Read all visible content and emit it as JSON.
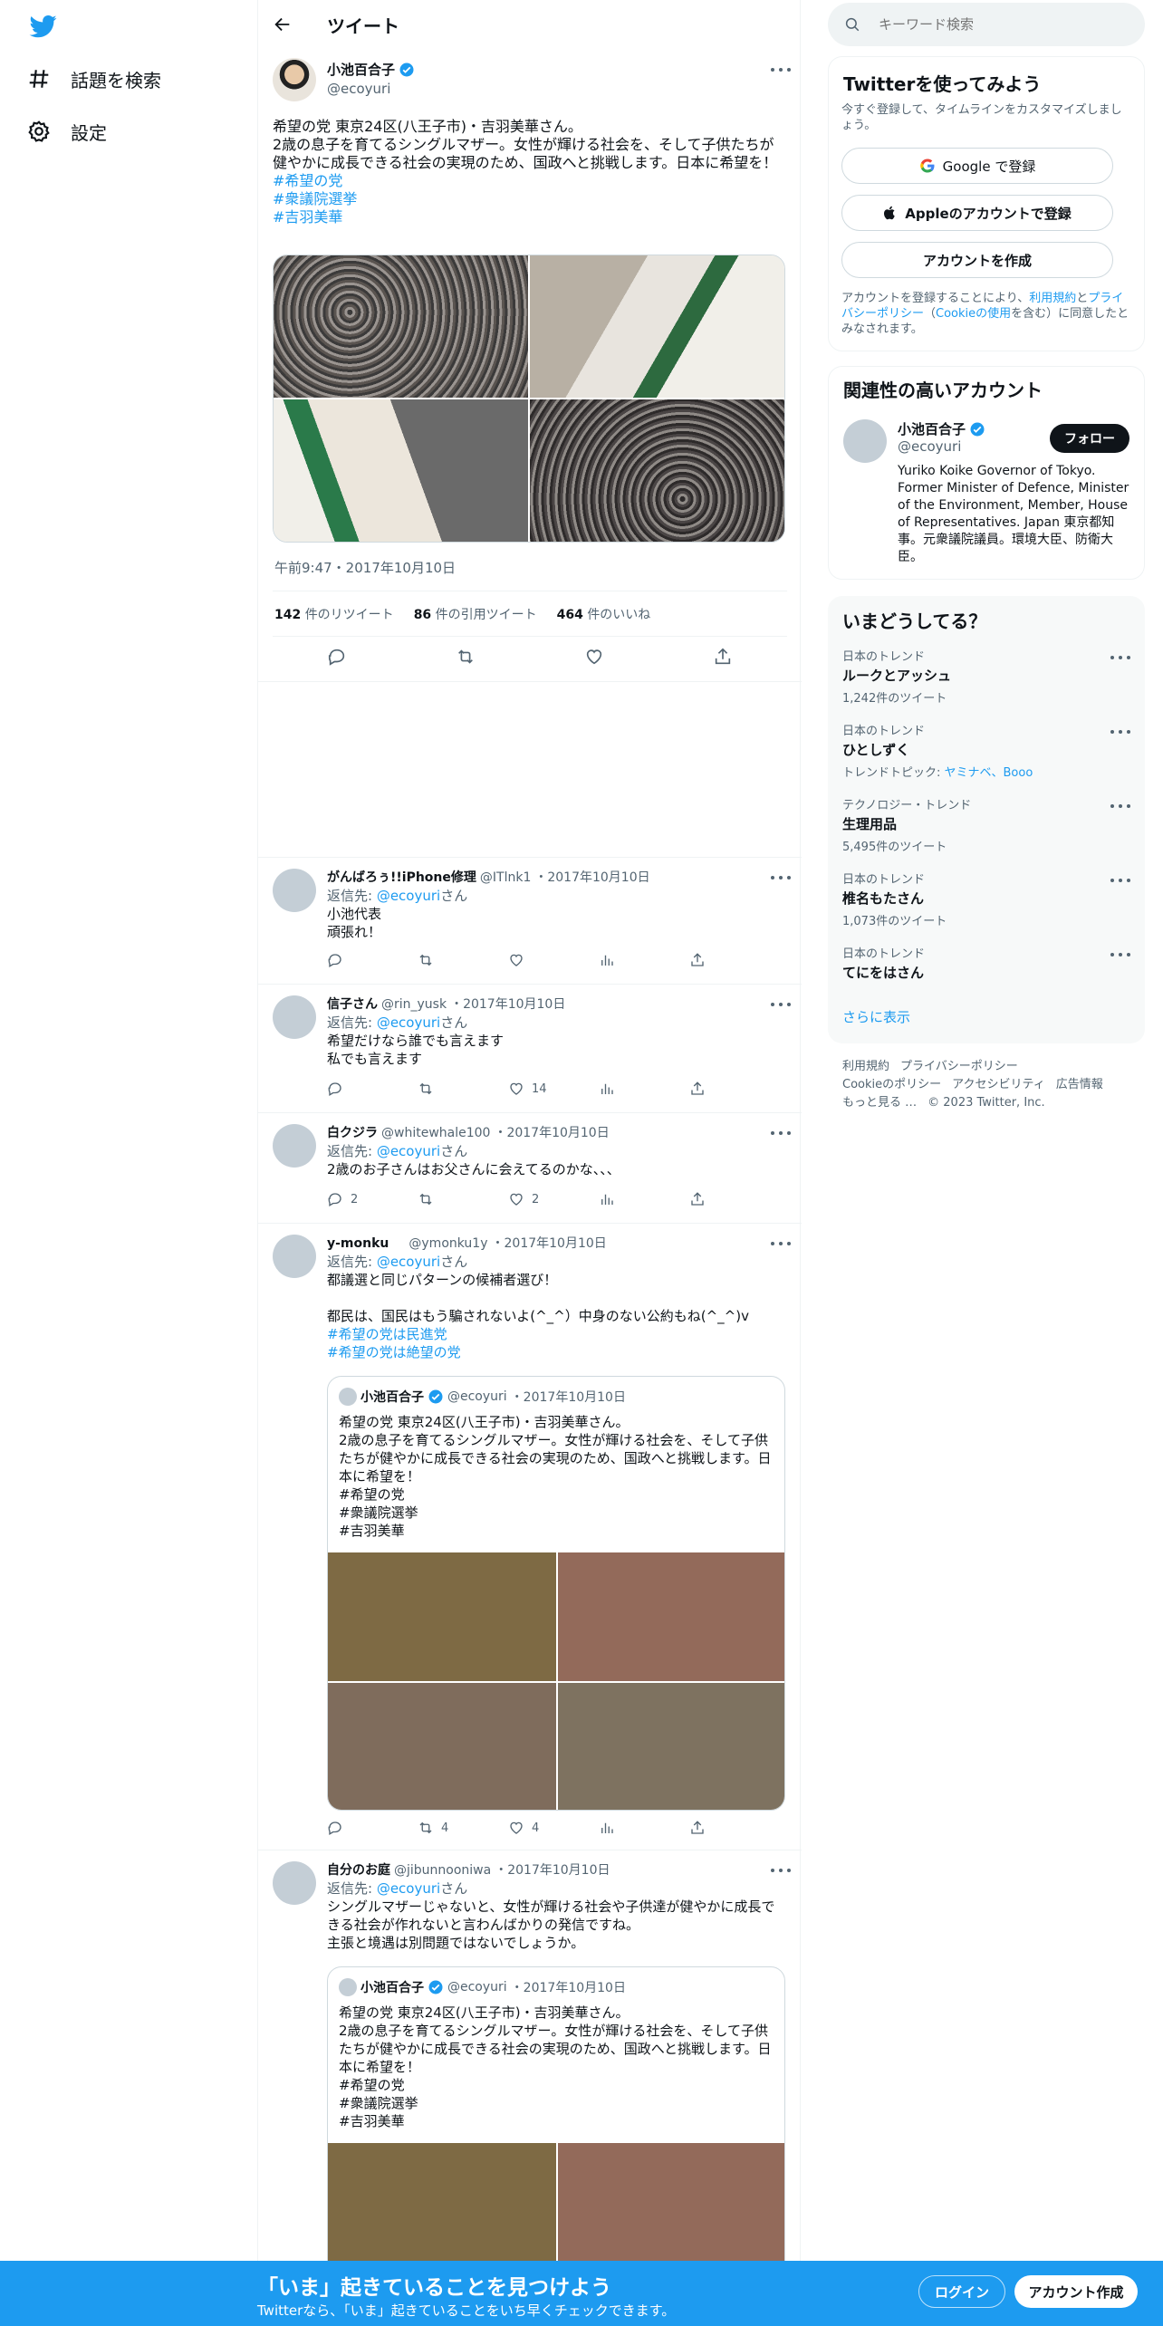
{
  "nav": {
    "explore_label": "話題を検索",
    "settings_label": "設定"
  },
  "header": {
    "title": "ツイート"
  },
  "tweet": {
    "author_name": "小池百合子",
    "author_handle": "@ecoyuri",
    "text": "希望の党 東京24区(八王子市)・吉羽美華さん。\n2歳の息子を育てるシングルマザー。女性が輝ける社会を、そして子供たちが健やかに成長できる社会の実現のため、国政へと挑戦します。日本に希望を！",
    "hashtags": [
      "#希望の党",
      "#衆議院選挙",
      "#吉羽美華"
    ],
    "timestamp": "午前9:47・2017年10月10日",
    "retweets": "142",
    "retweets_label": "件のリツイート",
    "quotes": "86",
    "quotes_label": "件の引用ツイート",
    "likes": "464",
    "likes_label": "件のいいね"
  },
  "replies": [
    {
      "name": "がんばろぅ!!iPhone修理",
      "handle": "@ITlnk1",
      "date": "・2017年10月10日",
      "to_prefix": "返信先: ",
      "to_handle": "@ecoyuri",
      "to_suffix": "さん",
      "lines": [
        "小池代表",
        "頑張れ！"
      ],
      "reply_count": "",
      "retweet_count": "",
      "like_count": ""
    },
    {
      "name": "信子さん",
      "handle": "@rin_yusk",
      "date": "・2017年10月10日",
      "to_prefix": "返信先: ",
      "to_handle": "@ecoyuri",
      "to_suffix": "さん",
      "lines": [
        "希望だけなら誰でも言えます",
        "私でも言えます"
      ],
      "reply_count": "",
      "retweet_count": "",
      "like_count": "14"
    },
    {
      "name": "白クジラ",
      "handle": "@whitewhale100",
      "date": "・2017年10月10日",
      "to_prefix": "返信先: ",
      "to_handle": "@ecoyuri",
      "to_suffix": "さん",
      "lines": [
        "2歳のお子さんはお父さんに会えてるのかな、、、"
      ],
      "reply_count": "2",
      "retweet_count": "",
      "like_count": "2"
    },
    {
      "name": "y-monku",
      "handle": "@ymonku1y",
      "date": "・2017年10月10日",
      "to_prefix": "返信先: ",
      "to_handle": "@ecoyuri",
      "to_suffix": "さん",
      "lines": [
        "都議選と同じパターンの候補者選び！",
        "",
        "都民は、国民はもう騙されないよ(^_^）中身のない公約もね(^_^)v"
      ],
      "hashtags": [
        "#希望の党は民進党",
        "#希望の党は絶望の党"
      ],
      "reply_count": "",
      "retweet_count": "4",
      "like_count": "4"
    },
    {
      "name": "自分のお庭",
      "handle": "@jibunnooniwa",
      "date": "・2017年10月10日",
      "to_prefix": "返信先: ",
      "to_handle": "@ecoyuri",
      "to_suffix": "さん",
      "lines": [
        "シングルマザーじゃないと、女性が輝ける社会や子供達が健やかに成長できる社会が作れないと言わんばかりの発信ですね。",
        "主張と境遇は別問題ではないでしょうか。"
      ]
    }
  ],
  "quote": {
    "name": "小池百合子",
    "handle": "@ecoyuri",
    "date": "・2017年10月10日",
    "lines": [
      "希望の党 東京24区(八王子市)・吉羽美華さん。",
      "2歳の息子を育てるシングルマザー。女性が輝ける社会を、そして子供たちが健やかに成長できる社会の実現のため、国政へと挑戦します。日本に希望を！",
      "#希望の党",
      "#衆議院選挙",
      "#吉羽美華"
    ]
  },
  "search": {
    "placeholder": "キーワード検索"
  },
  "signup_box": {
    "title": "Twitterを使ってみよう",
    "subtitle": "今すぐ登録して、タイムラインをカスタマイズしましょう。",
    "google_label": "Google で登録",
    "apple_label": "Appleのアカウントで登録",
    "create_label": "アカウントを作成",
    "terms_pre": "アカウントを登録することにより、",
    "terms_link": "利用規約",
    "terms_mid": "と",
    "privacy_link": "プライバシーポリシー",
    "cookie_pre": "（",
    "cookie_link": "Cookieの使用",
    "terms_post": "を含む）に同意したとみなされます。"
  },
  "related": {
    "title": "関連性の高いアカウント",
    "name": "小池百合子",
    "handle": "@ecoyuri",
    "follow_label": "フォロー",
    "bio": "Yuriko Koike Governor of Tokyo. Former Minister of Defence, Minister of the Environment, Member, House of Representatives. Japan 東京都知事。元衆議院議員。環境大臣、防衛大臣。"
  },
  "trends": {
    "title": "いまどうしてる？",
    "items": [
      {
        "category": "日本のトレンド",
        "name": "ルークとアッシュ",
        "count": "1,242件のツイート"
      },
      {
        "category": "日本のトレンド",
        "name": "ひとしずく",
        "topic_prefix": "トレンドトピック: ",
        "topic_links": "ヤミナベ、Booo"
      },
      {
        "category": "テクノロジー・トレンド",
        "name": "生理用品",
        "count": "5,495件のツイート"
      },
      {
        "category": "日本のトレンド",
        "name": "椎名もたさん",
        "count": "1,073件のツイート"
      },
      {
        "category": "日本のトレンド",
        "name": "てにをはさん",
        "count": ""
      }
    ],
    "show_more": "さらに表示"
  },
  "footer": {
    "terms": "利用規約",
    "privacy": "プライバシーポリシー",
    "cookie": "Cookieのポリシー",
    "accessibility": "アクセシビリティ",
    "ads": "広告情報",
    "more": "もっと見る …",
    "copyright": "© 2023 Twitter, Inc."
  },
  "bottom_bar": {
    "headline": "「いま」起きていることを見つけよう",
    "sub": "Twitterなら、「いま」起きていることをいち早くチェックできます。",
    "login": "ログイン",
    "signup": "アカウント作成"
  },
  "colors": {
    "accent": "#1d9bf0",
    "text": "#0f1419",
    "muted": "#536471"
  }
}
